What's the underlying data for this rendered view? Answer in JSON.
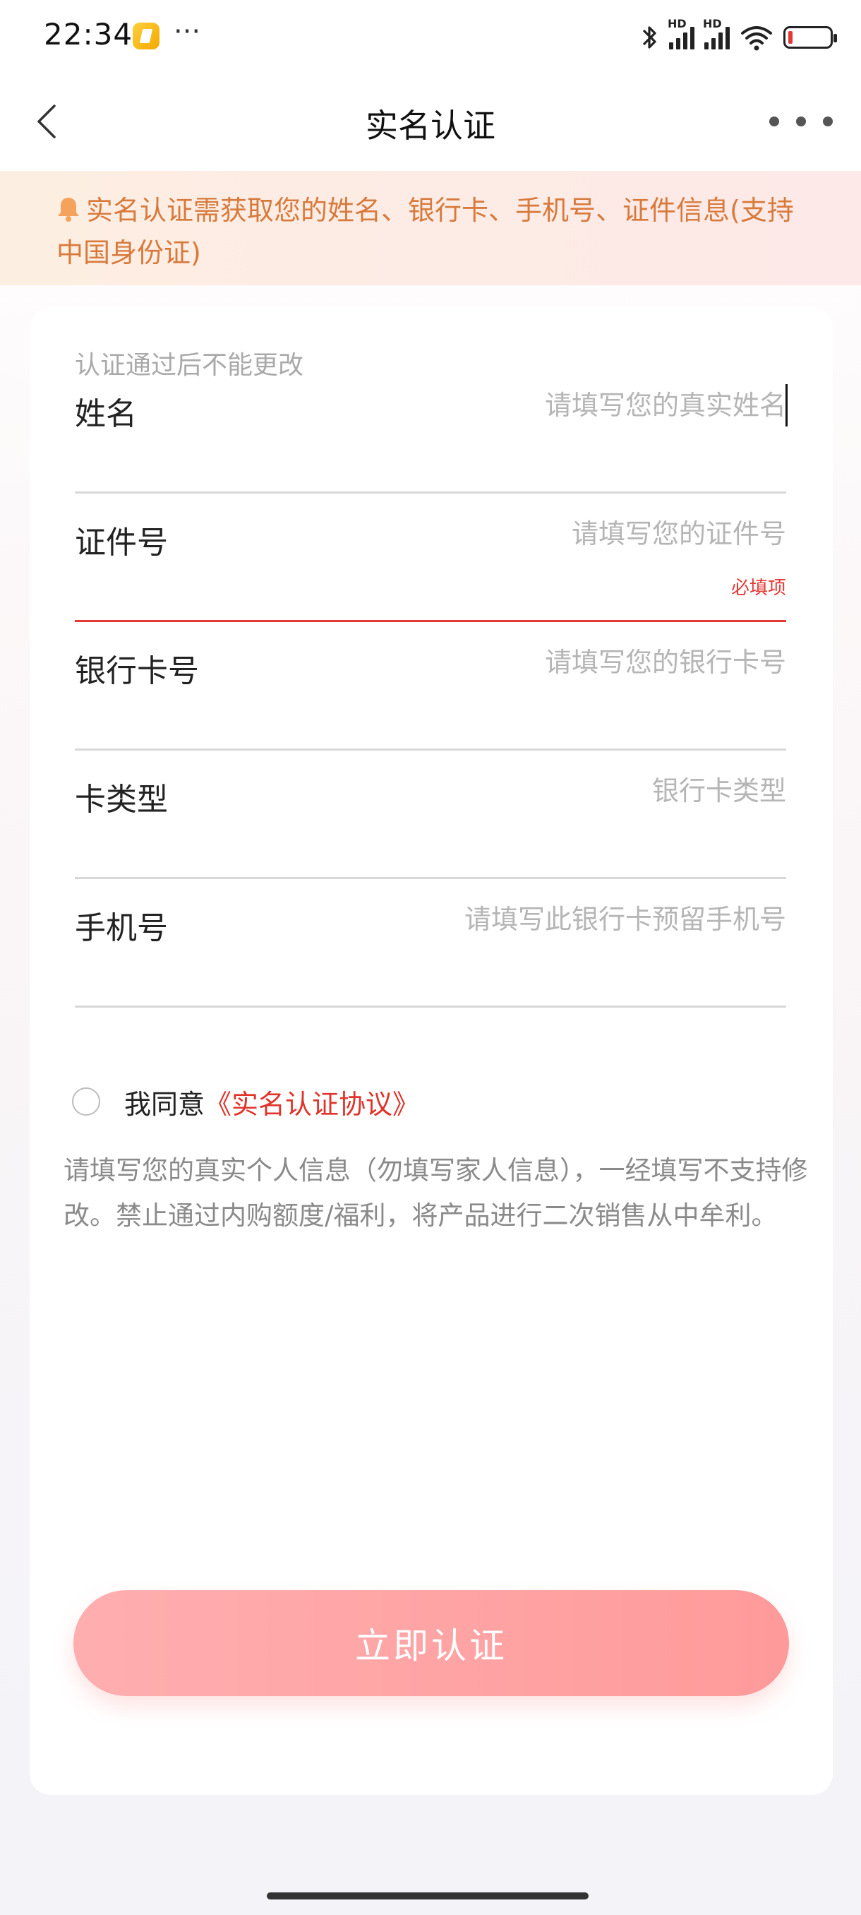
{
  "status_bar": {
    "time": "22:34",
    "overflow": "···",
    "signal_label_1": "HD",
    "signal_label_2": "HD"
  },
  "nav": {
    "title": "实名认证"
  },
  "notice": {
    "text": "实名认证需获取您的姓名、银行卡、手机号、证件信息(支持中国身份证)"
  },
  "form": {
    "hint": "认证通过后不能更改",
    "fields": [
      {
        "label": "姓名",
        "placeholder": "请填写您的真实姓名",
        "value": ""
      },
      {
        "label": "证件号",
        "placeholder": "请填写您的证件号",
        "value": "",
        "error": "必填项"
      },
      {
        "label": "银行卡号",
        "placeholder": "请填写您的银行卡号",
        "value": ""
      },
      {
        "label": "卡类型",
        "placeholder": "银行卡类型",
        "value": ""
      },
      {
        "label": "手机号",
        "placeholder": "请填写此银行卡预留手机号",
        "value": ""
      }
    ],
    "agree_prefix": "我同意",
    "agree_link": "《实名认证协议》",
    "disclaimer": "请填写您的真实个人信息（勿填写家人信息），一经填写不支持修改。禁止通过内购额度/福利，将产品进行二次销售从中牟利。",
    "submit_label": "立即认证"
  },
  "colors": {
    "accent": "#e0342b",
    "error": "#e53935",
    "notice_text": "#d77a3c",
    "button": "#ffa3a5"
  }
}
